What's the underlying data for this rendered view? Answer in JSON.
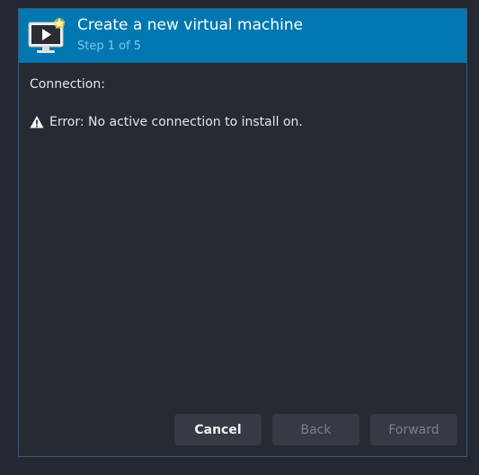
{
  "dialog": {
    "title": "Create a new virtual machine",
    "step": "Step 1 of 5",
    "icon": "vm-monitor-new-icon",
    "connection_label": "Connection:",
    "error_icon": "warning-icon",
    "error_message": "Error: No active connection to install on."
  },
  "buttons": {
    "cancel_label": "Cancel",
    "back_label": "Back",
    "forward_label": "Forward"
  },
  "colors": {
    "header_bg": "#0077b0",
    "dialog_bg": "#262a33",
    "button_bg": "#353a44",
    "disabled_text": "#7b808a"
  }
}
